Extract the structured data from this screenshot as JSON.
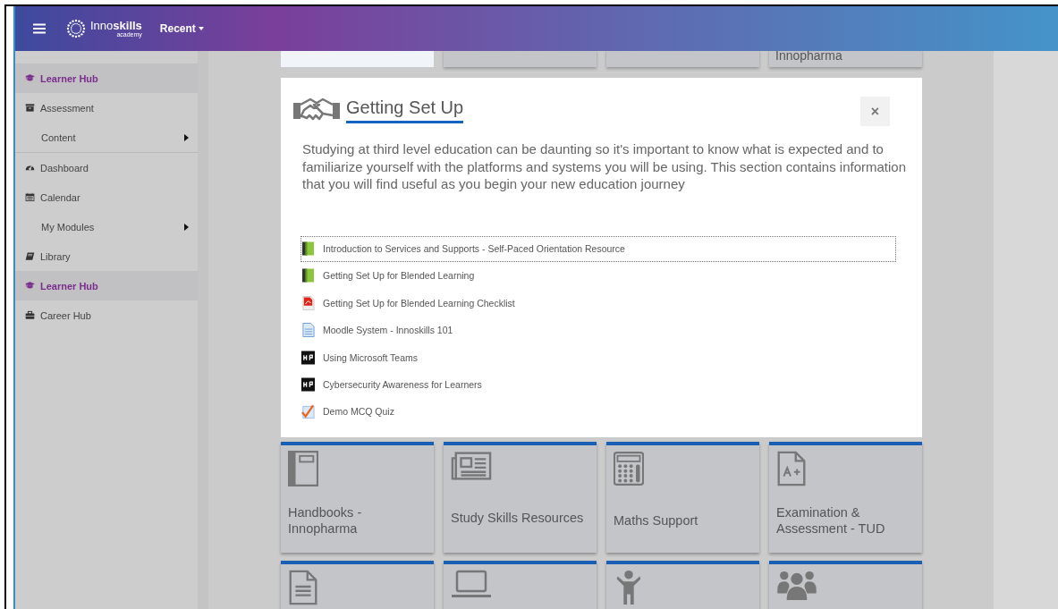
{
  "header": {
    "brand": "Inno**skills**",
    "brand_sub": "academy",
    "recent": "Recent"
  },
  "sidebar": {
    "items": [
      {
        "label": "Learner Hub",
        "kind": "section"
      },
      {
        "label": "Assessment",
        "kind": "link"
      },
      {
        "label": "Content",
        "kind": "submenu"
      },
      {
        "label": "Dashboard",
        "kind": "link"
      },
      {
        "label": "Calendar",
        "kind": "link"
      },
      {
        "label": "My Modules",
        "kind": "submenu"
      },
      {
        "label": "Library",
        "kind": "link"
      },
      {
        "label": "Learner Hub",
        "kind": "section"
      },
      {
        "label": "Career Hub",
        "kind": "link"
      }
    ]
  },
  "top_tiles": [
    {
      "selected": true
    },
    {
      "selected": false
    },
    {
      "selected": false
    },
    {
      "label": "Innopharma",
      "selected": false
    }
  ],
  "modal": {
    "title": "Getting Set Up",
    "close": "×",
    "intro": "Studying at third level education can be daunting so it's important to know what is expected and to familiarize yourself with the platforms and systems you will be using. This section contains information that you will find useful as you begin your new education journey",
    "links": [
      {
        "label": "Introduction to Services and Supports - Self-Paced Orientation Resource",
        "kind": "book",
        "focused": true
      },
      {
        "label": "Getting Set Up for Blended Learning",
        "kind": "book",
        "focused": false
      },
      {
        "label": "Getting Set Up for Blended Learning Checklist",
        "kind": "pdf",
        "focused": false
      },
      {
        "label": "Moodle System - Innoskills 101",
        "kind": "page",
        "focused": false
      },
      {
        "label": "Using Microsoft Teams",
        "kind": "h5p",
        "focused": false
      },
      {
        "label": "Cybersecurity Awareness for Learners",
        "kind": "h5p",
        "focused": false
      },
      {
        "label": "Demo MCQ Quiz",
        "kind": "quiz",
        "focused": false
      }
    ]
  },
  "tiles": [
    {
      "label": "Handbooks - Innopharma",
      "kind": "notebook"
    },
    {
      "label": "Study Skills Resources",
      "kind": "newspaper"
    },
    {
      "label": "Maths Support",
      "kind": "calculator"
    },
    {
      "label": "Examination & Assessment - TUD",
      "kind": "grade"
    },
    {
      "kind": "document"
    },
    {
      "kind": "laptop"
    },
    {
      "kind": "person"
    },
    {
      "kind": "group"
    }
  ]
}
